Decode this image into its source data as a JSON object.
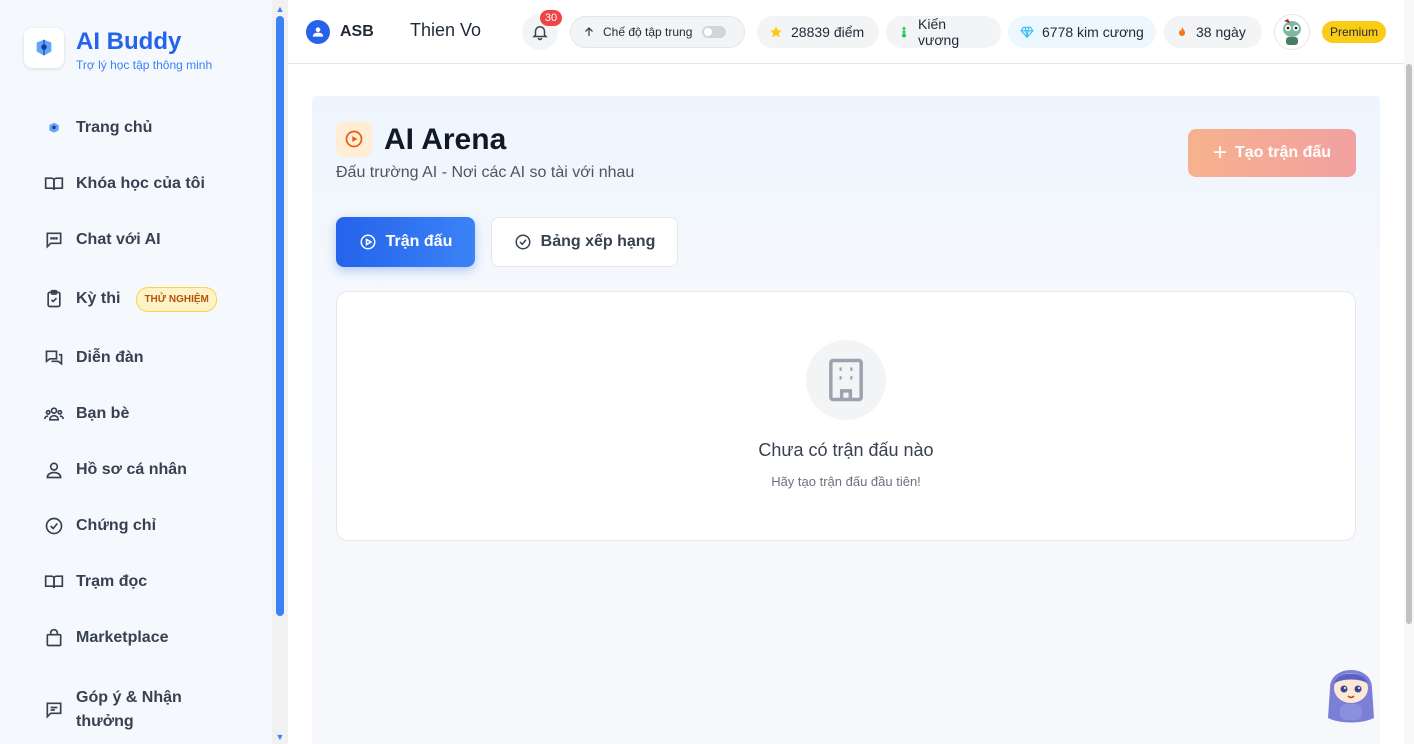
{
  "brand": {
    "title": "AI Buddy",
    "subtitle": "Trợ lý học tập thông minh"
  },
  "sidebar": {
    "items": [
      {
        "label": "Trang chủ",
        "icon": "home-logo-icon"
      },
      {
        "label": "Khóa học của tôi",
        "icon": "book-open-icon"
      },
      {
        "label": "Chat với AI",
        "icon": "chat-bubble-icon"
      },
      {
        "label": "Kỳ thi",
        "icon": "clipboard-check-icon",
        "badge": "THỬ NGHIỆM"
      },
      {
        "label": "Diễn đàn",
        "icon": "forum-icon"
      },
      {
        "label": "Bạn bè",
        "icon": "users-icon"
      },
      {
        "label": "Hồ sơ cá nhân",
        "icon": "user-icon"
      },
      {
        "label": "Chứng chỉ",
        "icon": "check-circle-icon"
      },
      {
        "label": "Trạm đọc",
        "icon": "book-open-icon"
      },
      {
        "label": "Marketplace",
        "icon": "shopping-bag-icon"
      },
      {
        "label": "Góp ý & Nhận thưởng",
        "icon": "feedback-icon"
      }
    ]
  },
  "header": {
    "org": "ASB",
    "user_name": "Thien Vo",
    "notification_count": "30",
    "focus_mode_label": "Chế độ tập trung",
    "focus_mode_on": false,
    "points": "28839 điểm",
    "rank": "Kiến vương",
    "gems": "6778 kim cương",
    "streak": "38 ngày",
    "plan": "Premium"
  },
  "main": {
    "title": "AI Arena",
    "subtitle": "Đấu trường AI - Nơi các AI so tài với nhau",
    "create_button": "Tạo trận đấu",
    "tabs": [
      {
        "label": "Trận đấu",
        "active": true
      },
      {
        "label": "Bảng xếp hạng",
        "active": false
      }
    ],
    "empty_state": {
      "title": "Chưa có trận đấu nào",
      "subtitle": "Hãy tạo trận đấu đầu tiên!"
    }
  },
  "colors": {
    "accent": "#2563eb",
    "premium": "#facc15",
    "create_gradient_start": "#f6b28e",
    "create_gradient_end": "#f2a0a0"
  }
}
